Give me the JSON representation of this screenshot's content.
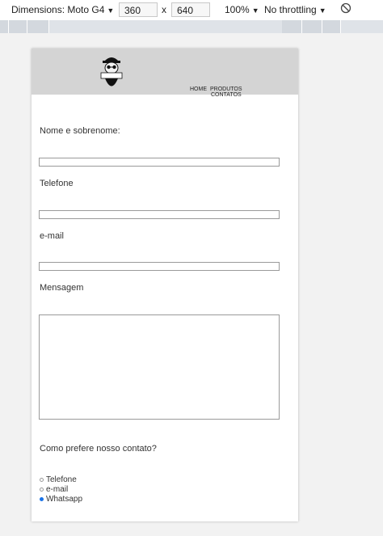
{
  "devtools": {
    "dimensions_label": "Dimensions: Moto G4",
    "width_value": "360",
    "times_sign": "x",
    "height_value": "640",
    "zoom_label": "100%",
    "throttling_label": "No throttling"
  },
  "site": {
    "nav": [
      "HOME",
      "PRODUTOS",
      "CONTATOS"
    ],
    "form": {
      "name_label": "Nome e sobrenome:",
      "phone_label": "Telefone",
      "email_label": "e-mail",
      "message_label": "Mensagem",
      "contact_pref_label": "Como prefere nosso contato?",
      "options": [
        "Telefone",
        "e-mail",
        "Whatsapp"
      ],
      "selected_option": "Whatsapp"
    }
  },
  "colors": {
    "header_bg": "#d4d4d4",
    "radio_checked": "#1a73e8"
  }
}
